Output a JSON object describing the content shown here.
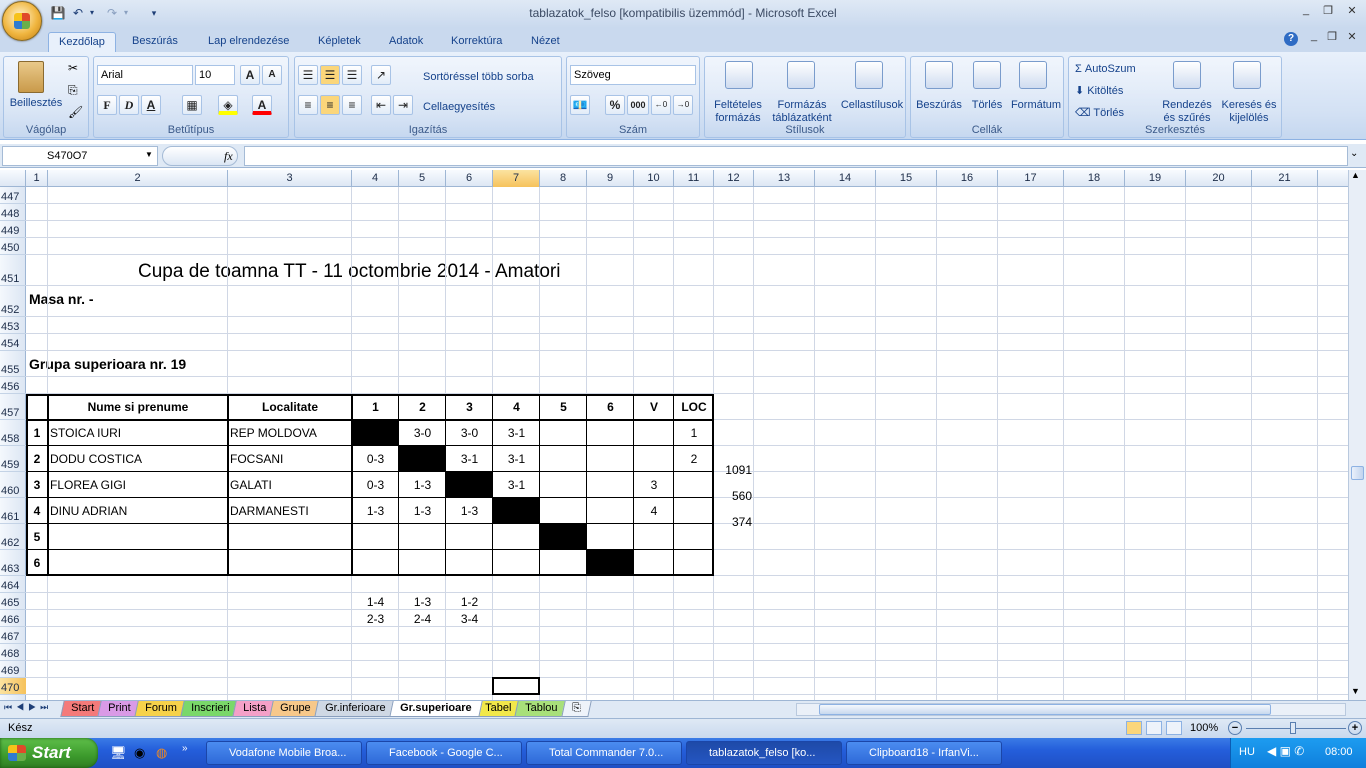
{
  "window": {
    "title": "tablazatok_felso  [kompatibilis üzemmód] - Microsoft Excel",
    "min": "_",
    "max": "❐",
    "close": "✕",
    "doc_min": "_",
    "doc_max": "❐",
    "doc_close": "✕",
    "help": "?"
  },
  "ribbon_tabs": [
    "Kezdőlap",
    "Beszúrás",
    "Lap elrendezése",
    "Képletek",
    "Adatok",
    "Korrektúra",
    "Nézet"
  ],
  "ribbon": {
    "clipboard": {
      "label": "Vágólap",
      "paste": "Beillesztés"
    },
    "font": {
      "label": "Betűtípus",
      "name": "Arial",
      "size": "10",
      "bold": "F",
      "italic": "D",
      "underline": "A"
    },
    "alignment": {
      "label": "Igazítás",
      "wrap": "Sortöréssel több sorba",
      "merge": "Cellaegyesítés"
    },
    "number": {
      "label": "Szám",
      "format": "Szöveg",
      "percent": "%",
      "thousands": "000"
    },
    "styles": {
      "label": "Stílusok",
      "cond": "Feltételes formázás",
      "table": "Formázás táblázatként",
      "cell": "Cellastílusok"
    },
    "cells": {
      "label": "Cellák",
      "insert": "Beszúrás",
      "delete": "Törlés",
      "format": "Formátum"
    },
    "editing": {
      "label": "Szerkesztés",
      "autosum": "AutoSzum",
      "fill": "Kitöltés",
      "clear": "Törlés",
      "sort": "Rendezés és szűrés",
      "find": "Keresés és kijelölés"
    }
  },
  "formula_bar": {
    "name_box": "S470O7",
    "fx": "fx",
    "value": ""
  },
  "columns": [
    "1",
    "2",
    "3",
    "4",
    "5",
    "6",
    "7",
    "8",
    "9",
    "10",
    "11",
    "12",
    "13",
    "14",
    "15",
    "16",
    "17",
    "18",
    "19",
    "20",
    "21"
  ],
  "selected_column": "7",
  "rows": [
    "447",
    "448",
    "449",
    "450",
    "451",
    "452",
    "453",
    "454",
    "455",
    "456",
    "457",
    "458",
    "459",
    "460",
    "461",
    "462",
    "463",
    "464",
    "465",
    "466",
    "467",
    "468",
    "469",
    "470"
  ],
  "selected_row": "470",
  "sheet": {
    "title": "Cupa de toamna TT - 11 octombrie 2014 - Amatori",
    "masa": "Masa nr.  -",
    "group": "Grupa superioara nr. 19",
    "table_headers": [
      "Nume si prenume",
      "Localitate",
      "1",
      "2",
      "3",
      "4",
      "5",
      "6",
      "V",
      "LOC"
    ],
    "players": [
      {
        "no": "1",
        "name": "STOICA IURI",
        "city": "REP MOLDOVA",
        "r": [
          "",
          "3-0",
          "3-0",
          "3-1",
          "",
          ""
        ],
        "v": "",
        "loc": "1"
      },
      {
        "no": "2",
        "name": "DODU COSTICA",
        "city": "FOCSANI",
        "r": [
          "0-3",
          "",
          "3-1",
          "3-1",
          "",
          ""
        ],
        "v": "",
        "loc": "2"
      },
      {
        "no": "3",
        "name": "FLOREA GIGI",
        "city": "GALATI",
        "r": [
          "0-3",
          "1-3",
          "",
          "3-1",
          "",
          ""
        ],
        "v": "3",
        "loc": ""
      },
      {
        "no": "4",
        "name": "DINU ADRIAN",
        "city": "DARMANESTI",
        "r": [
          "1-3",
          "1-3",
          "1-3",
          "",
          "",
          ""
        ],
        "v": "4",
        "loc": ""
      },
      {
        "no": "5",
        "name": "",
        "city": "",
        "r": [
          "",
          "",
          "",
          "",
          "",
          ""
        ],
        "v": "",
        "loc": ""
      },
      {
        "no": "6",
        "name": "",
        "city": "",
        "r": [
          "",
          "",
          "",
          "",
          "",
          ""
        ],
        "v": "",
        "loc": ""
      }
    ],
    "side_values": [
      "1091",
      "560",
      "374"
    ],
    "pairs_row1": [
      "1-4",
      "1-3",
      "1-2"
    ],
    "pairs_row2": [
      "2-3",
      "2-4",
      "3-4"
    ]
  },
  "sheet_tabs": [
    "Start",
    "Print",
    "Forum",
    "Inscrieri",
    "Lista",
    "Grupe",
    "Gr.inferioare",
    "Gr.superioare",
    "Tabel",
    "Tablou"
  ],
  "active_sheet": "Gr.superioare",
  "status": {
    "ready": "Kész",
    "zoom": "100%"
  },
  "taskbar": {
    "start": "Start",
    "items": [
      "Vodafone Mobile Broa...",
      "Facebook - Google C...",
      "Total Commander 7.0...",
      "tablazatok_felso  [ko...",
      "Clipboard18 - IrfanVi..."
    ],
    "lang": "HU",
    "time": "08:00"
  }
}
